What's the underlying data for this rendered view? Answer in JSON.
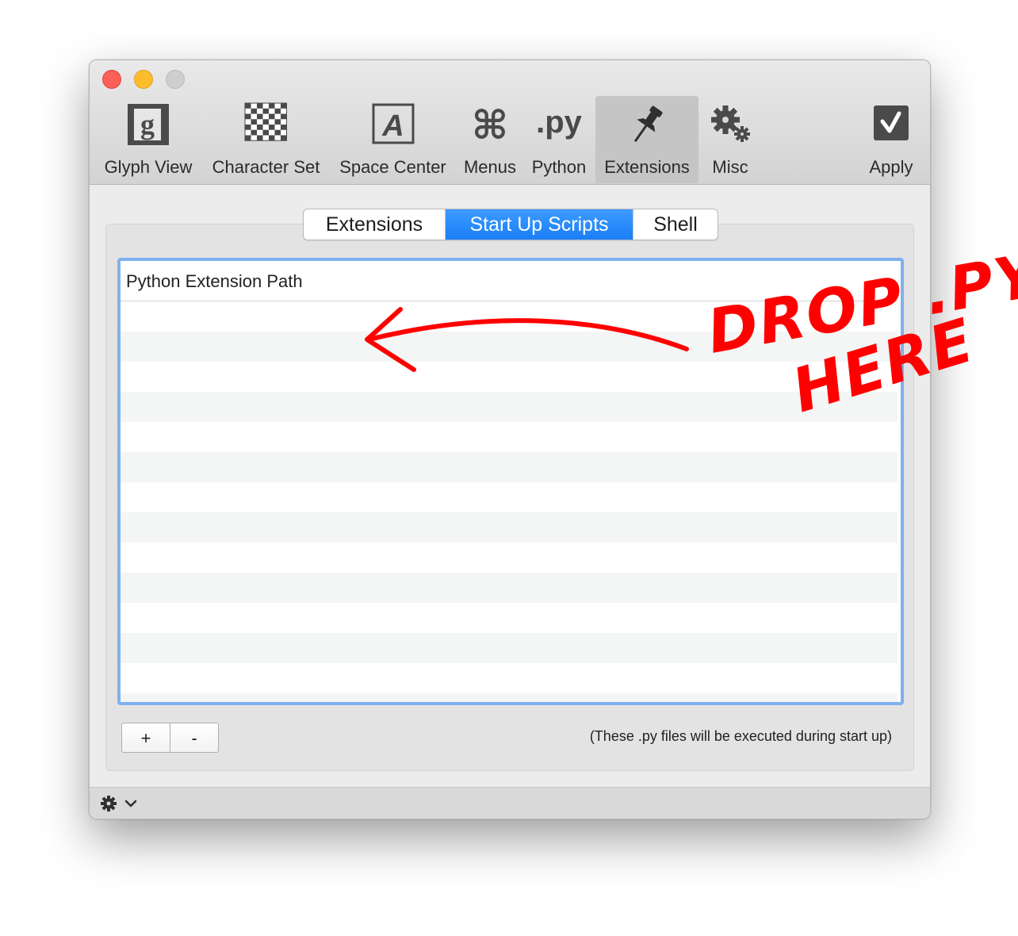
{
  "toolbar": {
    "items": [
      {
        "label": "Glyph View",
        "icon": "glyph-view-icon"
      },
      {
        "label": "Character Set",
        "icon": "checkerboard-icon"
      },
      {
        "label": "Space Center",
        "icon": "space-center-icon"
      },
      {
        "label": "Menus",
        "icon": "command-icon"
      },
      {
        "label": "Python",
        "icon": "python-icon"
      },
      {
        "label": "Extensions",
        "icon": "pushpin-icon"
      },
      {
        "label": "Misc",
        "icon": "gears-icon"
      },
      {
        "label": "Apply",
        "icon": "apply-check-icon"
      }
    ],
    "active": "Extensions",
    "python_glyph": ".py",
    "glyph_letter": "g",
    "space_letter": "A",
    "command_glyph": "⌘"
  },
  "tabs": {
    "items": [
      "Extensions",
      "Start Up Scripts",
      "Shell"
    ],
    "selected": "Start Up Scripts"
  },
  "table": {
    "column_header": "Python Extension Path",
    "rows": []
  },
  "buttons": {
    "add": "+",
    "remove": "-"
  },
  "hint": "(These .py files will be executed during start up)",
  "annotation": {
    "line1": "DROP .PY",
    "line2": "HERE",
    "color": "#ff0000"
  },
  "colors": {
    "selected_tab": "#1a7ef7",
    "focus_ring": "#7fb0ef",
    "close": "#fc5f57",
    "minimize": "#fdbc2e"
  }
}
